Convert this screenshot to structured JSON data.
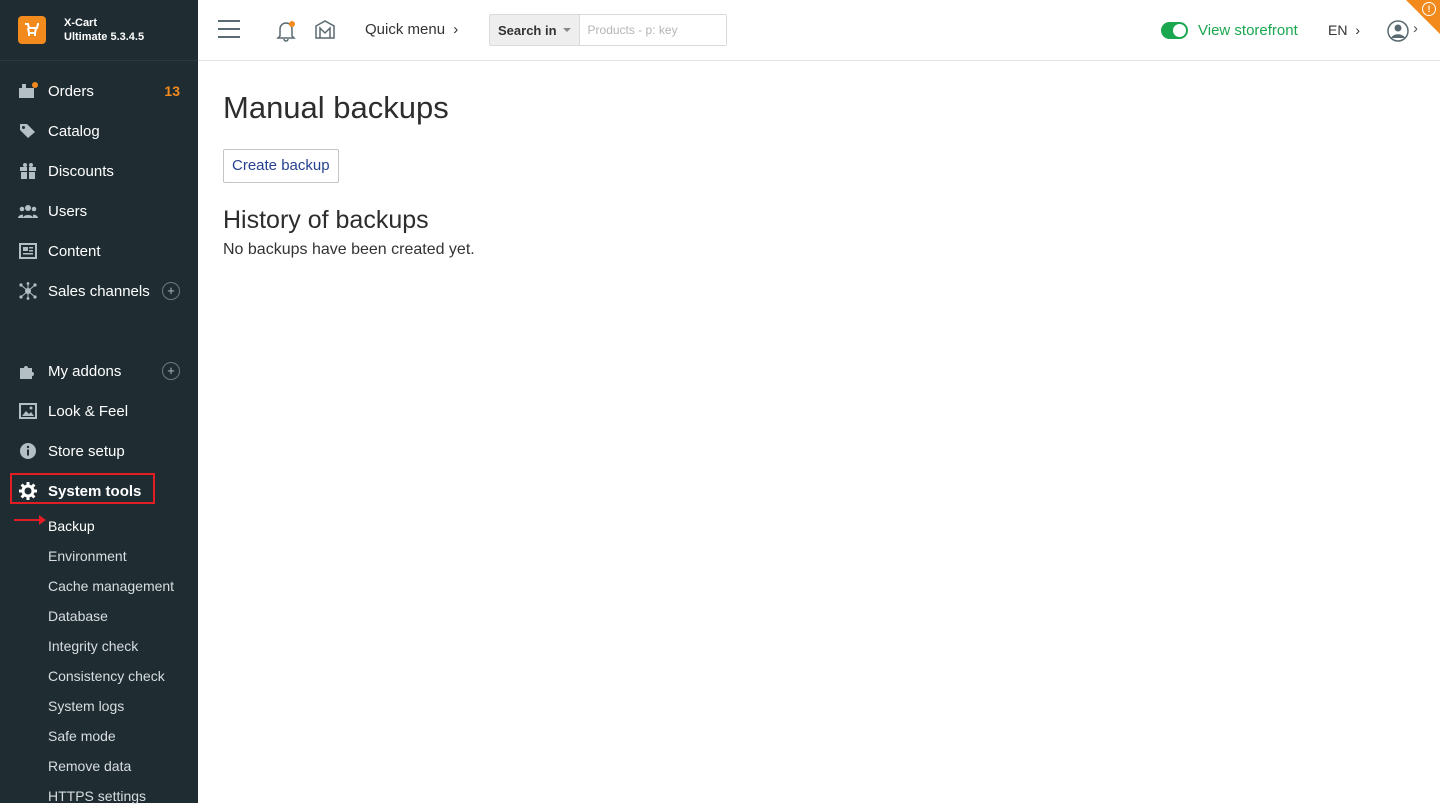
{
  "brand": {
    "name": "X-Cart",
    "edition": "Ultimate 5.3.4.5"
  },
  "sidebar": {
    "items": [
      {
        "label": "Orders",
        "icon": "orders-icon",
        "badge": "13"
      },
      {
        "label": "Catalog",
        "icon": "tag-icon"
      },
      {
        "label": "Discounts",
        "icon": "gift-icon"
      },
      {
        "label": "Users",
        "icon": "users-icon"
      },
      {
        "label": "Content",
        "icon": "newspaper-icon"
      },
      {
        "label": "Sales channels",
        "icon": "network-icon"
      }
    ],
    "items2": [
      {
        "label": "My addons",
        "icon": "puzzle-icon"
      },
      {
        "label": "Look & Feel",
        "icon": "image-icon"
      },
      {
        "label": "Store setup",
        "icon": "info-icon"
      },
      {
        "label": "System tools",
        "icon": "gear-icon"
      }
    ],
    "subitems": [
      "Backup",
      "Environment",
      "Cache management",
      "Database",
      "Integrity check",
      "Consistency check",
      "System logs",
      "Safe mode",
      "Remove data",
      "HTTPS settings"
    ]
  },
  "topbar": {
    "quick_menu": "Quick menu",
    "search_scope": "Search in",
    "search_placeholder": "Products - p: key",
    "view_storefront": "View storefront",
    "language": "EN",
    "chevron": "›"
  },
  "main": {
    "title": "Manual backups",
    "create_button": "Create backup",
    "history_title": "History of backups",
    "empty_message": "No backups have been created yet."
  },
  "colors": {
    "accent": "#f28a1d",
    "sidebar": "#1f2d33",
    "green": "#1aa750",
    "highlight": "#e31d24"
  }
}
